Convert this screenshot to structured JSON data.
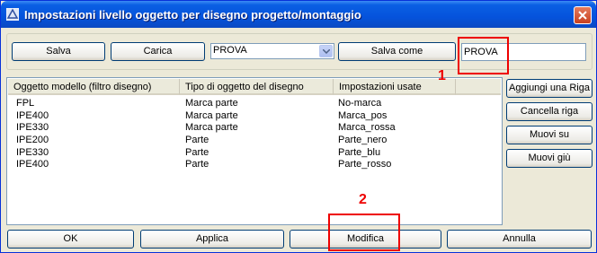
{
  "window": {
    "title": "Impostazioni livello oggetto per disegno progetto/montaggio"
  },
  "toolbar": {
    "save_label": "Salva",
    "load_label": "Carica",
    "combo_value": "PROVA",
    "save_as_label": "Salva come",
    "name_value": "PROVA"
  },
  "table": {
    "columns": [
      "Oggetto modello (filtro disegno)",
      "Tipo di oggetto del disegno",
      "Impostazioni usate"
    ],
    "rows": [
      [
        "FPL",
        "Marca parte",
        "No-marca"
      ],
      [
        "IPE400",
        "Marca parte",
        "Marca_pos"
      ],
      [
        "IPE330",
        "Marca parte",
        "Marca_rossa"
      ],
      [
        "IPE200",
        "Parte",
        "Parte_nero"
      ],
      [
        "IPE330",
        "Parte",
        "Parte_blu"
      ],
      [
        "IPE400",
        "Parte",
        "Parte_rosso"
      ]
    ]
  },
  "side_buttons": {
    "add_row": "Aggiungi una Riga",
    "delete_row": "Cancella riga",
    "move_up": "Muovi su",
    "move_down": "Muovi giù"
  },
  "bottom_buttons": {
    "ok": "OK",
    "apply": "Applica",
    "modify": "Modifica",
    "cancel": "Annulla"
  },
  "annotations": {
    "label_1": "1",
    "label_2": "2",
    "color": "#e00000"
  }
}
